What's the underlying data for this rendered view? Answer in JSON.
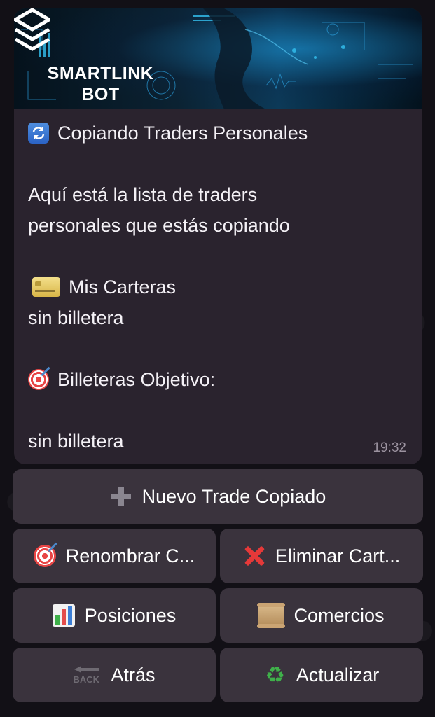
{
  "banner": {
    "brand_line1": "SMARTLINK",
    "brand_line2": "BOT"
  },
  "message": {
    "title": "Copiando Traders Personales",
    "intro_line1": "Aquí está la lista de traders",
    "intro_line2": "personales que estás copiando",
    "my_wallets_heading": "Mis Carteras",
    "my_wallets_value": "sin billetera",
    "target_wallets_heading": "Billeteras Objetivo:",
    "target_wallets_value": "sin billetera",
    "time": "19:32"
  },
  "keyboard": {
    "new_trade": "Nuevo Trade Copiado",
    "rename": "Renombrar C...",
    "delete": "Eliminar Cart...",
    "positions": "Posiciones",
    "trades": "Comercios",
    "back": "Atrás",
    "back_icon_text": "BACK",
    "refresh": "Actualizar"
  },
  "icons": {
    "title": "refresh-icon",
    "my_wallets": "credit-card-icon",
    "target_wallets": "target-icon",
    "new_trade": "plus-icon",
    "rename": "target-icon",
    "delete": "cross-mark-icon",
    "positions": "bar-chart-icon",
    "trades": "scroll-icon",
    "back": "back-arrow-icon",
    "refresh": "recycle-icon"
  },
  "colors": {
    "bubble": "#2a232e",
    "button": "#3a333d",
    "timestamp": "#9b929f"
  }
}
